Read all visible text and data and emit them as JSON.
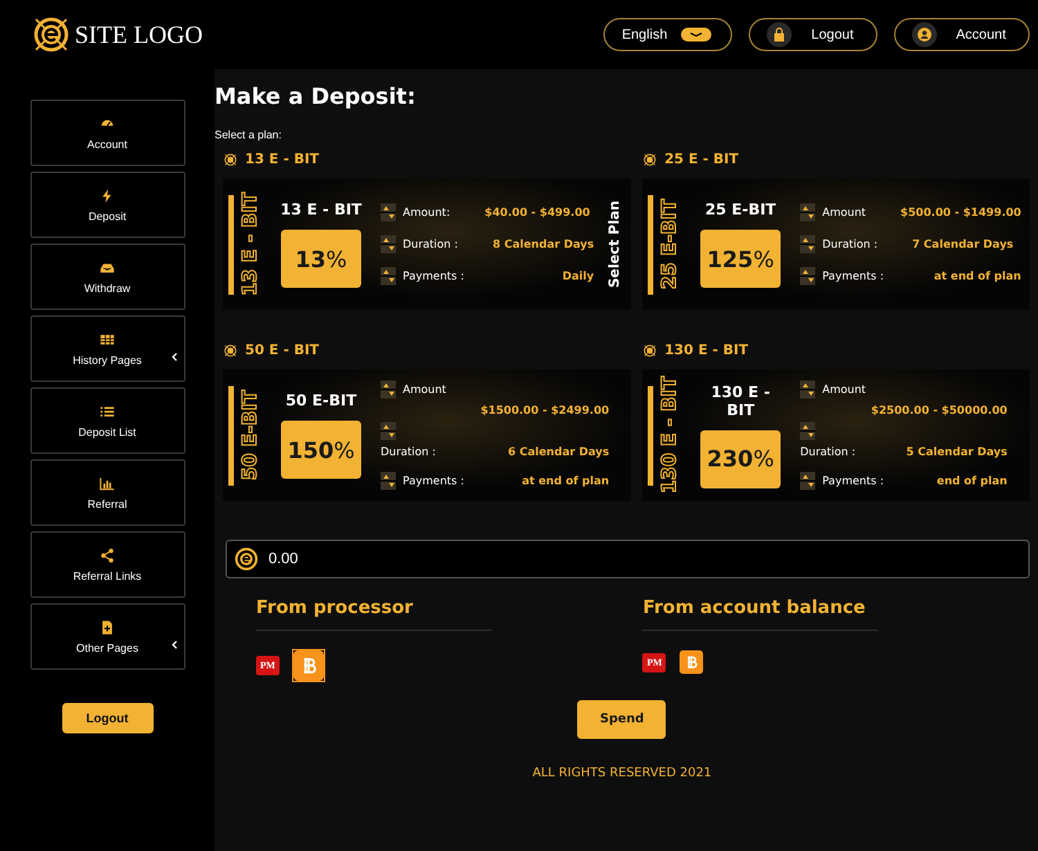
{
  "header": {
    "logo_text": "SITE LOGO",
    "language": "English",
    "buttons": [
      {
        "label": "Logout",
        "kind": "lock"
      },
      {
        "label": "Account",
        "kind": "user"
      }
    ]
  },
  "sidebar": {
    "items": [
      {
        "label": "Account",
        "submenu": false
      },
      {
        "label": "Deposit",
        "submenu": false
      },
      {
        "label": "Withdraw",
        "submenu": false
      },
      {
        "label": "History Pages",
        "submenu": true
      },
      {
        "label": "Deposit List",
        "submenu": false
      },
      {
        "label": "Referral",
        "submenu": false
      },
      {
        "label": "Referral Links",
        "submenu": false
      },
      {
        "label": "Other Pages",
        "submenu": true
      }
    ],
    "logout": "Logout"
  },
  "main": {
    "title": "Make a Deposit:",
    "hint": "Select a plan:",
    "plans": [
      {
        "name": "13 E - BIT",
        "side_label": "13 E - BIT",
        "card_title": "13 E - BIT",
        "rate": "13",
        "unit": "%",
        "kind": "inline",
        "amount_label": "Amount:",
        "amount": "$40.00 - $499.00",
        "duration_label": "Duration :",
        "duration": "8 Calendar Days",
        "payments_label": "Payments :",
        "payments": "Daily",
        "action": "Select Plan"
      },
      {
        "name": "25 E - BIT",
        "side_label": "25 E-BIT",
        "card_title": "25 E-BIT",
        "rate": "125",
        "unit": "%",
        "kind": "inline",
        "amount_label": "Amount",
        "amount": "$500.00 - $1499.00",
        "duration_label": "Duration :",
        "duration": "7 Calendar Days",
        "payments_label": "Payments :",
        "payments": "at end of plan"
      },
      {
        "name": "50 E - BIT",
        "side_label": "50 E-BIT",
        "card_title": "50 E-BIT",
        "rate": "150",
        "unit": "%",
        "kind": "stacked",
        "amount_label": "Amount",
        "amount": "$1500.00 - $2499.00",
        "duration_label": "Duration :",
        "duration": "6 Calendar Days",
        "payments_label": "Payments :",
        "payments": "at end of plan"
      },
      {
        "name": "130 E - BIT",
        "side_label": "130 E - BIT",
        "card_title": "130 E - BIT",
        "rate": "230",
        "unit": "%",
        "kind": "stacked",
        "amount_label": "Amount",
        "amount": "$2500.00 - $50000.00",
        "duration_label": "Duration :",
        "duration": "5 Calendar Days",
        "payments_label": "Payments :",
        "payments": "end of plan"
      }
    ],
    "amount_field": {
      "value": "0.00"
    },
    "sources": [
      {
        "title": "From processor",
        "methods": [
          {
            "kind": "pm",
            "label": "PM",
            "selected": false
          },
          {
            "kind": "btc",
            "selected": true
          }
        ]
      },
      {
        "title": "From account balance",
        "methods": [
          {
            "kind": "pm",
            "label": "PM",
            "selected": false
          },
          {
            "kind": "btc",
            "selected": false
          }
        ]
      }
    ],
    "submit": "Spend",
    "footer": "ALL RIGHTS RESERVED 2021"
  }
}
